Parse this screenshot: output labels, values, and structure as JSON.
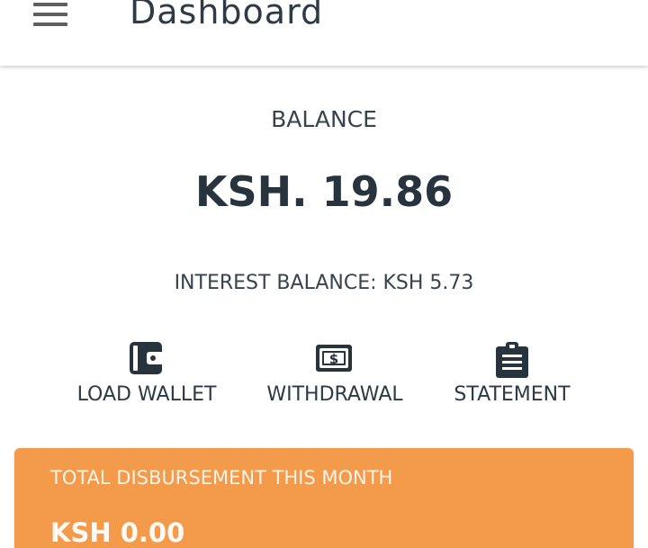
{
  "header": {
    "title": "Dashboard",
    "menu_icon": "hamburger-menu-icon"
  },
  "balance": {
    "label": "BALANCE",
    "amount": "KSH. 19.86",
    "interest": "INTEREST BALANCE: KSH 5.73"
  },
  "actions": [
    {
      "label": "LOAD WALLET",
      "icon": "wallet-icon"
    },
    {
      "label": "WITHDRAWAL",
      "icon": "money-bill-icon"
    },
    {
      "label": "STATEMENT",
      "icon": "clipboard-list-icon"
    }
  ],
  "disbursement": {
    "title": "TOTAL DISBURSEMENT THIS MONTH",
    "amount": "KSH 0.00"
  },
  "colors": {
    "accent": "#f39b4a",
    "text": "#2d3a45"
  }
}
